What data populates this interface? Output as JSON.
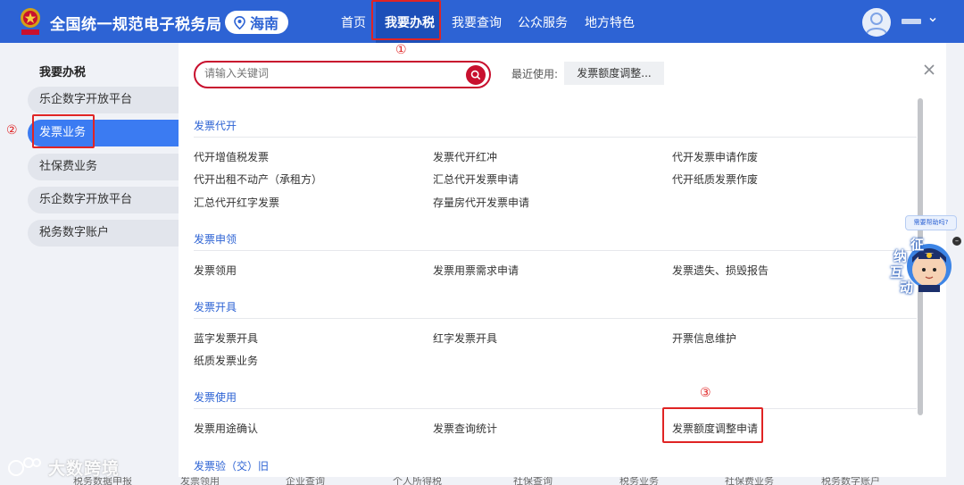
{
  "header": {
    "site_title": "全国统一规范电子税务局",
    "region": "海南",
    "nav": [
      "首页",
      "我要办税",
      "我要查询",
      "公众服务",
      "地方特色"
    ],
    "active_nav": "我要办税"
  },
  "sidebar": {
    "title": "我要办税",
    "items": [
      "乐企数字开放平台",
      "发票业务",
      "社保费业务",
      "乐企数字开放平台",
      "税务数字账户"
    ],
    "active": "发票业务"
  },
  "search": {
    "placeholder": "请输入关键词",
    "recent_label": "最近使用:",
    "recent_item": "发票额度调整..."
  },
  "sections": [
    {
      "title": "发票代开",
      "links": [
        "代开增值税发票",
        "发票代开红冲",
        "代开发票申请作废",
        "代开出租不动产（承租方）",
        "汇总代开发票申请",
        "代开纸质发票作废",
        "汇总代开红字发票",
        "存量房代开发票申请"
      ]
    },
    {
      "title": "发票申领",
      "links": [
        "发票领用",
        "发票用票需求申请",
        "发票遗失、损毁报告"
      ]
    },
    {
      "title": "发票开具",
      "links": [
        "蓝字发票开具",
        "红字发票开具",
        "开票信息维护",
        "纸质发票业务"
      ]
    },
    {
      "title": "发票使用",
      "links": [
        "发票用途确认",
        "发票查询统计",
        "发票额度调整申请"
      ]
    },
    {
      "title": "发票验（交）旧",
      "links": []
    }
  ],
  "annotations": [
    "①",
    "②",
    "③"
  ],
  "assistant": {
    "bubble": "需要帮助吗?",
    "chars": [
      "征",
      "纳",
      "互",
      "动"
    ]
  },
  "watermark": "大数跨境",
  "bottom_strip": [
    "税务数据申报",
    "发票领用",
    "企业查询",
    "个人所得税",
    "社保查询",
    "税务业务",
    "发票业务",
    "社保费业务",
    "税务数字账户"
  ],
  "colors": {
    "header": "#2d63d4",
    "active_nav": "#1d4fb8",
    "side_active": "#3b7bf2",
    "search_red": "#c8102e",
    "annotation_red": "#e02424",
    "section_blue": "#2d63d4"
  }
}
